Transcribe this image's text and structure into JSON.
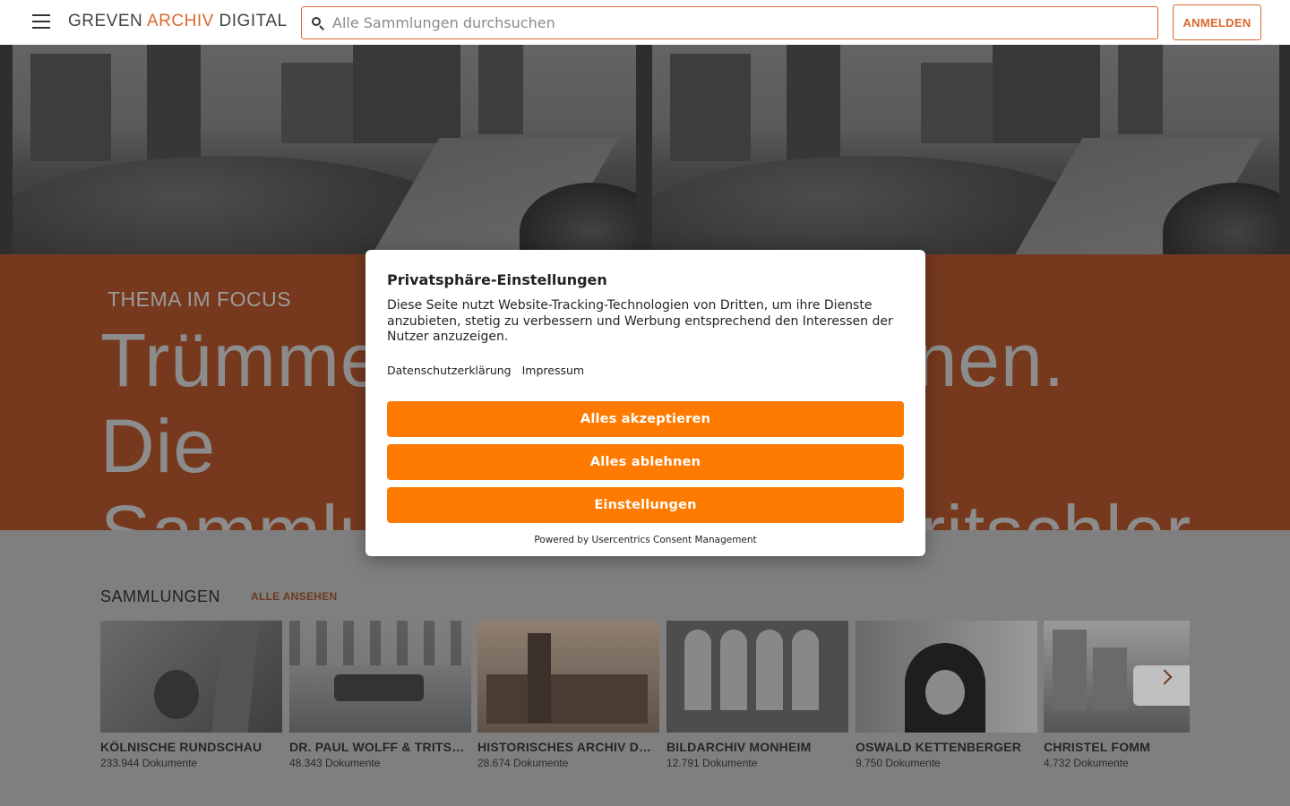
{
  "header": {
    "logo_part1": "GREVEN ",
    "logo_part2": "ARCHIV",
    "logo_part3": " DIGITAL",
    "search_placeholder": "Alle Sammlungen durchsuchen",
    "login_label": "ANMELDEN"
  },
  "theme": {
    "label": "THEMA IM FOCUS",
    "title_line1": "Trümmerfrauen und Ruinen. Die",
    "title_line2": "Sammlung Dr. Wolff & Tritschler"
  },
  "collections": {
    "heading": "SAMMLUNGEN",
    "see_all": "ALLE ANSEHEN",
    "items": [
      {
        "title": "KÖLNISCHE RUNDSCHAU",
        "count": "233.944 Dokumente"
      },
      {
        "title": "DR. PAUL WOLFF & TRITSCHLER",
        "count": "48.343 Dokumente"
      },
      {
        "title": "HISTORISCHES ARCHIV DER STADT",
        "count": "28.674 Dokumente"
      },
      {
        "title": "BILDARCHIV MONHEIM",
        "count": "12.791 Dokumente"
      },
      {
        "title": "OSWALD KETTENBERGER",
        "count": "9.750 Dokumente"
      },
      {
        "title": "CHRISTEL FOMM",
        "count": "4.732 Dokumente"
      }
    ]
  },
  "consent": {
    "title": "Privatsphäre-Einstellungen",
    "text": "Diese Seite nutzt Website-Tracking-Technologien von Dritten, um ihre Dienste anzubieten, stetig zu verbessern und Werbung entsprechend den Interessen der Nutzer anzuzeigen.",
    "link_privacy": "Datenschutzerklärung",
    "link_imprint": "Impressum",
    "accept_all": "Alles akzeptieren",
    "reject_all": "Alles ablehnen",
    "settings": "Einstellungen",
    "powered_by": "Powered by Usercentrics Consent Management"
  },
  "colors": {
    "accent": "#d8692e",
    "consent_button": "#ff7a00"
  }
}
